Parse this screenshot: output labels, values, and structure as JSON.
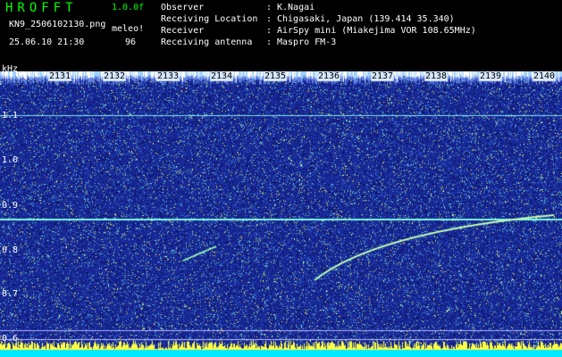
{
  "header": {
    "brand": "HROFFT",
    "version": "1.0.0f",
    "filename": "KN9_2506102130.png",
    "mode": "meleo!",
    "datetime": "25.06.10 21:30",
    "count": "96"
  },
  "info": [
    {
      "label": "Observer",
      "value": "K.Nagai"
    },
    {
      "label": "Receiving Location",
      "value": "Chigasaki, Japan (139.414 35.340)"
    },
    {
      "label": "Receiver",
      "value": "AirSpy mini (Miakejima VOR 108.65MHz)"
    },
    {
      "label": "Receiving antenna",
      "value": "Maspro FM-3"
    }
  ],
  "spectrogram": {
    "y_unit": "kHz",
    "y_ticks": [
      "1.1",
      "1.0",
      "0.9",
      "0.8",
      "0.7",
      "0.6"
    ],
    "x_ticks": [
      "2131",
      "2132",
      "2133",
      "2134",
      "2135",
      "2136",
      "2137",
      "2138",
      "2139",
      "2140"
    ],
    "colors": {
      "background": "#1a2a9c",
      "signal": "#7ff7e0",
      "noise_hot": "#ffff40",
      "bottom_band": "#00e8ff"
    }
  }
}
